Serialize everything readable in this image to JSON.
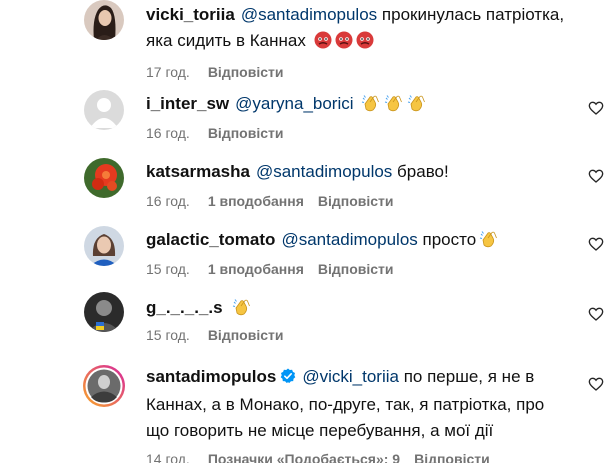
{
  "comments": [
    {
      "username": "vicki_toriia",
      "mention": "@santadimopulos",
      "text_line1": "прокинулась патріотка,",
      "text_line2": "яка сидить в Каннах",
      "emoji": "rage-face",
      "time": "17 год.",
      "likes": "",
      "reply": "Відповісти",
      "avatar": "woman-dark-hair"
    },
    {
      "username": "i_inter_sw",
      "mention": "@yaryna_borici",
      "text_line1": "",
      "emoji": "clapping-hands",
      "time": "16 год.",
      "likes": "",
      "reply": "Відповісти",
      "avatar": "default-silhouette"
    },
    {
      "username": "katsarmasha",
      "mention": "@santadimopulos",
      "text_line1": "браво!",
      "time": "16 год.",
      "likes": "1 вподобання",
      "reply": "Відповісти",
      "avatar": "red-flower"
    },
    {
      "username": "galactic_tomato",
      "mention": "@santadimopulos",
      "text_line1": "просто",
      "emoji": "clapping-hands",
      "time": "15 год.",
      "likes": "1 вподобання",
      "reply": "Відповісти",
      "avatar": "woman-blue"
    },
    {
      "username": "g_._._._.s",
      "mention": "",
      "text_line1": "",
      "emoji": "clapping-hands",
      "time": "15 год.",
      "likes": "",
      "reply": "Відповісти",
      "avatar": "dark-photo"
    },
    {
      "username": "santadimopulos",
      "mention": "@vicki_toriia",
      "text_line1": "по перше, я не в",
      "text_line2": "Каннах, а в Монако, по-друге, так, я патріотка, про",
      "text_line3": "що говорить не місце перебування, а мої дії",
      "time": "14 год.",
      "likes": "Позначки «Подобається»: 9",
      "reply": "Відповісти",
      "avatar": "story-ring-photo",
      "verified": true
    }
  ],
  "icons": {
    "like": "heart-outline-icon",
    "verified": "verified-badge-icon"
  },
  "colors": {
    "mention": "#00376b",
    "meta": "#737373",
    "verified": "#0095f6",
    "story_ring_start": "#f9a825",
    "story_ring_end": "#d6249f"
  }
}
